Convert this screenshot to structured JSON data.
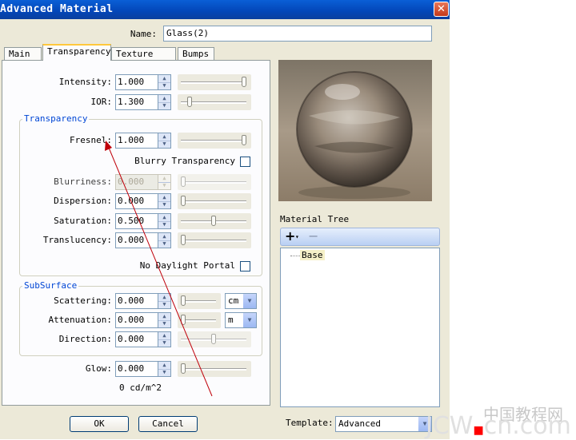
{
  "window": {
    "title": "Advanced Material",
    "close_icon": "close-icon"
  },
  "name": {
    "label": "Name:",
    "value": "Glass(2)"
  },
  "tabs": [
    {
      "label": "Main",
      "active": false
    },
    {
      "label": "Transparency",
      "active": true
    },
    {
      "label": "Texture Maps",
      "active": false
    },
    {
      "label": "Bumps",
      "active": false
    }
  ],
  "fields": {
    "intensity": {
      "label": "Intensity:",
      "value": "1.000",
      "slider_level": 1.0
    },
    "ior": {
      "label": "IOR:",
      "value": "1.300",
      "slider_level": 0.1
    }
  },
  "transparency_group": {
    "title": "Transparency",
    "fresnel": {
      "label": "Fresnel:",
      "value": "1.000",
      "slider_level": 1.0
    },
    "blurry_label": "Blurry Transparency",
    "blurry_checked": false,
    "blurriness": {
      "label": "Blurriness:",
      "value": "0.000",
      "slider_level": 0.0,
      "disabled": true
    },
    "dispersion": {
      "label": "Dispersion:",
      "value": "0.000",
      "slider_level": 0.0
    },
    "saturation": {
      "label": "Saturation:",
      "value": "0.500",
      "slider_level": 0.5
    },
    "translucency": {
      "label": "Translucency:",
      "value": "0.000",
      "slider_level": 0.0
    },
    "no_daylight_label": "No Daylight Portal",
    "no_daylight_checked": false
  },
  "subsurface_group": {
    "title": "SubSurface",
    "scattering": {
      "label": "Scattering:",
      "value": "0.000",
      "unit": "cm",
      "slider_level": 0.0
    },
    "attenuation": {
      "label": "Attenuation:",
      "value": "0.000",
      "unit": "m",
      "slider_level": 0.0
    },
    "direction": {
      "label": "Direction:",
      "value": "0.000",
      "slider_level": 0.5
    }
  },
  "glow": {
    "label": "Glow:",
    "value": "0.000",
    "unit_text": "0 cd/m^2",
    "slider_level": 0.0
  },
  "buttons": {
    "ok": "OK",
    "cancel": "Cancel"
  },
  "material_tree": {
    "label": "Material Tree",
    "add_icon": "plus-icon",
    "remove_icon": "minus-icon",
    "items": [
      "Base"
    ]
  },
  "template": {
    "label": "Template:",
    "value": "Advanced"
  },
  "watermark": {
    "cn": "中国教程网",
    "latin_left": "JCW",
    "latin_right": "cn.com"
  },
  "colors": {
    "accent": "#0a5fd6",
    "annotation_arrow": "#c0000a",
    "group_title": "#0046d5"
  }
}
